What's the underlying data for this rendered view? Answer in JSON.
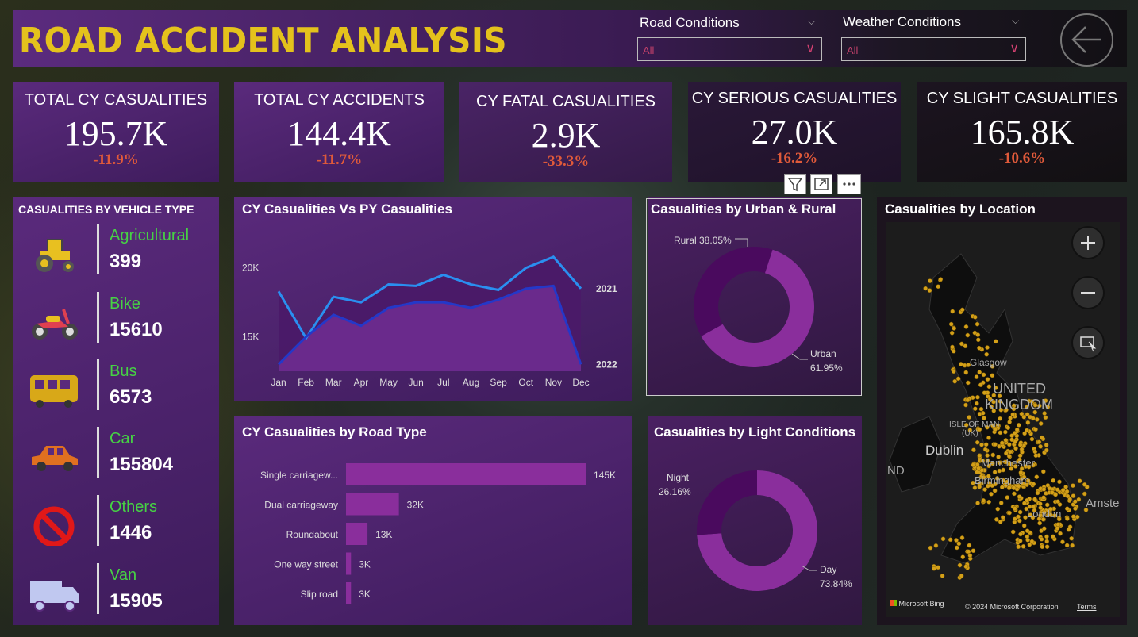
{
  "header": {
    "title": "ROAD ACCIDENT ANALYSIS",
    "road_conditions": {
      "label": "Road Conditions",
      "value": "All"
    },
    "weather_conditions": {
      "label": "Weather Conditions",
      "value": "All"
    }
  },
  "kpis": [
    {
      "title": "TOTAL CY CASUALITIES",
      "value": "195.7K",
      "delta": "-11.9%"
    },
    {
      "title": "TOTAL CY ACCIDENTS",
      "value": "144.4K",
      "delta": "-11.7%"
    },
    {
      "title": "CY FATAL CASUALITIES",
      "value": "2.9K",
      "delta": "-33.3%"
    },
    {
      "title": "CY SERIOUS CASUALITIES",
      "value": "27.0K",
      "delta": "-16.2%"
    },
    {
      "title": "CY SLIGHT CASUALITIES",
      "value": "165.8K",
      "delta": "-10.6%"
    }
  ],
  "vehicles": {
    "title": "CASUALITIES BY VEHICLE TYPE",
    "items": [
      {
        "name": "Agricultural",
        "value": "399",
        "icon": "tractor-icon"
      },
      {
        "name": "Bike",
        "value": "15610",
        "icon": "motorbike-icon"
      },
      {
        "name": "Bus",
        "value": "6573",
        "icon": "bus-icon"
      },
      {
        "name": "Car",
        "value": "155804",
        "icon": "car-icon"
      },
      {
        "name": "Others",
        "value": "1446",
        "icon": "no-entry-icon"
      },
      {
        "name": "Van",
        "value": "15905",
        "icon": "van-icon"
      }
    ]
  },
  "trend": {
    "title": "CY Casualities Vs PY Casualities",
    "months": [
      "Jan",
      "Feb",
      "Mar",
      "Apr",
      "May",
      "Jun",
      "Jul",
      "Aug",
      "Sep",
      "Oct",
      "Nov",
      "Dec"
    ],
    "yticks": [
      "20K",
      "15K"
    ],
    "labels": [
      "2021",
      "2022"
    ]
  },
  "urban_rural": {
    "title": "Casualities by Urban & Rural",
    "rural_label": "Rural 38.05%",
    "urban_label": "Urban",
    "urban_pct": "61.95%"
  },
  "location": {
    "title": "Casualities by Location",
    "map_labels": [
      "UNITED",
      "KINGDOM",
      "Dublin",
      "Manchester",
      "Birmingham",
      "London",
      "Amster",
      "ISLE OF MAN",
      "(UK)",
      "ND",
      "Glasgow"
    ],
    "bing": "Microsoft Bing",
    "copyright": "© 2024 Microsoft Corporation",
    "terms": "Terms"
  },
  "road_type": {
    "title": "CY Casualities by Road Type"
  },
  "light": {
    "title": "Casualities by Light Conditions",
    "night_label": "Night",
    "night_pct": "26.16%",
    "day_label": "Day",
    "day_pct": "73.84%"
  },
  "chart_data": [
    {
      "type": "area",
      "title": "CY Casualities Vs PY Casualities",
      "categories": [
        "Jan",
        "Feb",
        "Mar",
        "Apr",
        "May",
        "Jun",
        "Jul",
        "Aug",
        "Sep",
        "Oct",
        "Nov",
        "Dec"
      ],
      "series": [
        {
          "name": "2021",
          "values": [
            18300,
            14900,
            17900,
            17500,
            18800,
            18700,
            19500,
            18800,
            18400,
            20000,
            20800,
            18500
          ],
          "color": "#2a8ff0"
        },
        {
          "name": "2022",
          "values": [
            13000,
            15000,
            16600,
            15800,
            17100,
            17500,
            17500,
            17100,
            17700,
            18500,
            18700,
            13000
          ],
          "color": "#2438c8"
        }
      ],
      "ylim": [
        12500,
        22000
      ],
      "yticks": [
        15000,
        20000
      ]
    },
    {
      "type": "pie",
      "title": "Casualities by Urban & Rural",
      "labels": [
        "Urban",
        "Rural"
      ],
      "values": [
        61.95,
        38.05
      ],
      "colors": [
        "#8a2e9c",
        "#4a0a5e"
      ]
    },
    {
      "type": "bar",
      "title": "CY Casualities by Road Type",
      "categories": [
        "Single carriagew...",
        "Dual carriageway",
        "Roundabout",
        "One way street",
        "Slip road"
      ],
      "values": [
        145000,
        32000,
        13000,
        3000,
        3000
      ],
      "data_labels": [
        "145K",
        "32K",
        "13K",
        "3K",
        "3K"
      ],
      "color": "#8a2e9c"
    },
    {
      "type": "pie",
      "title": "Casualities by Light Conditions",
      "labels": [
        "Day",
        "Night"
      ],
      "values": [
        73.84,
        26.16
      ],
      "colors": [
        "#8a2e9c",
        "#4a0a5e"
      ]
    }
  ]
}
